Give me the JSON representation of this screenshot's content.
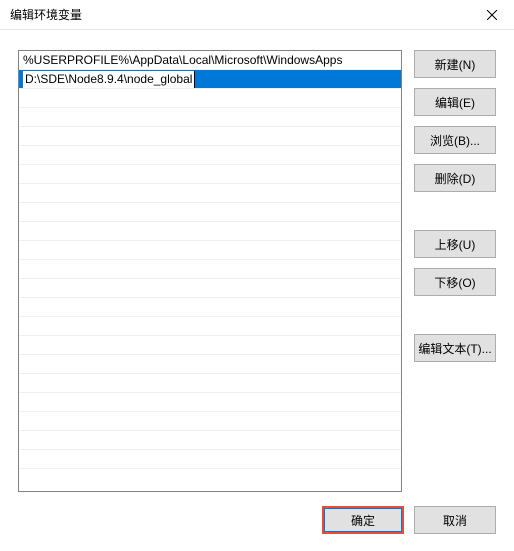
{
  "window": {
    "title": "编辑环境变量"
  },
  "list": {
    "items": [
      {
        "value": "%USERPROFILE%\\AppData\\Local\\Microsoft\\WindowsApps",
        "selected": false
      },
      {
        "value": "D:\\SDE\\Node8.9.4\\node_global",
        "selected": true
      }
    ],
    "visible_empty_rows": 20
  },
  "buttons": {
    "new": "新建(N)",
    "edit": "编辑(E)",
    "browse": "浏览(B)...",
    "delete": "删除(D)",
    "move_up": "上移(U)",
    "move_down": "下移(O)",
    "edit_text": "编辑文本(T)...",
    "ok": "确定",
    "cancel": "取消"
  }
}
